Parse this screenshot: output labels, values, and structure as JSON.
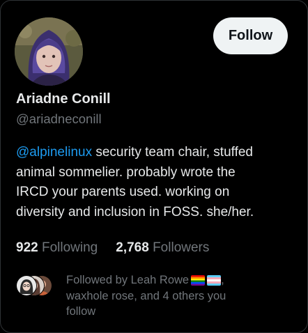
{
  "profile": {
    "name": "Ariadne Conill",
    "handle": "@ariadneconill",
    "follow_label": "Follow",
    "bio": {
      "mention": "@alpinelinux",
      "line1_rest": " security team chair, stuffed",
      "line2": "animal sommelier. probably wrote the",
      "line3": "IRCD your parents used. working on",
      "line4": "diversity and inclusion in FOSS. she/her."
    }
  },
  "stats": {
    "following_count": "922",
    "following_label": "Following",
    "followers_count": "2,768",
    "followers_label": "Followers"
  },
  "followed_by": {
    "line1": "Followed by Leah Rowe",
    "line1_suffix": ",",
    "line2": "waxhole rose, and 4 others you",
    "line3": "follow",
    "flags": [
      "rainbow-flag-icon",
      "transgender-flag-icon"
    ]
  },
  "colors": {
    "background": "#000000",
    "primary_text": "#e7e9ea",
    "secondary_text": "#71767b",
    "link": "#1d9bf0",
    "button_bg": "#eff3f4"
  }
}
